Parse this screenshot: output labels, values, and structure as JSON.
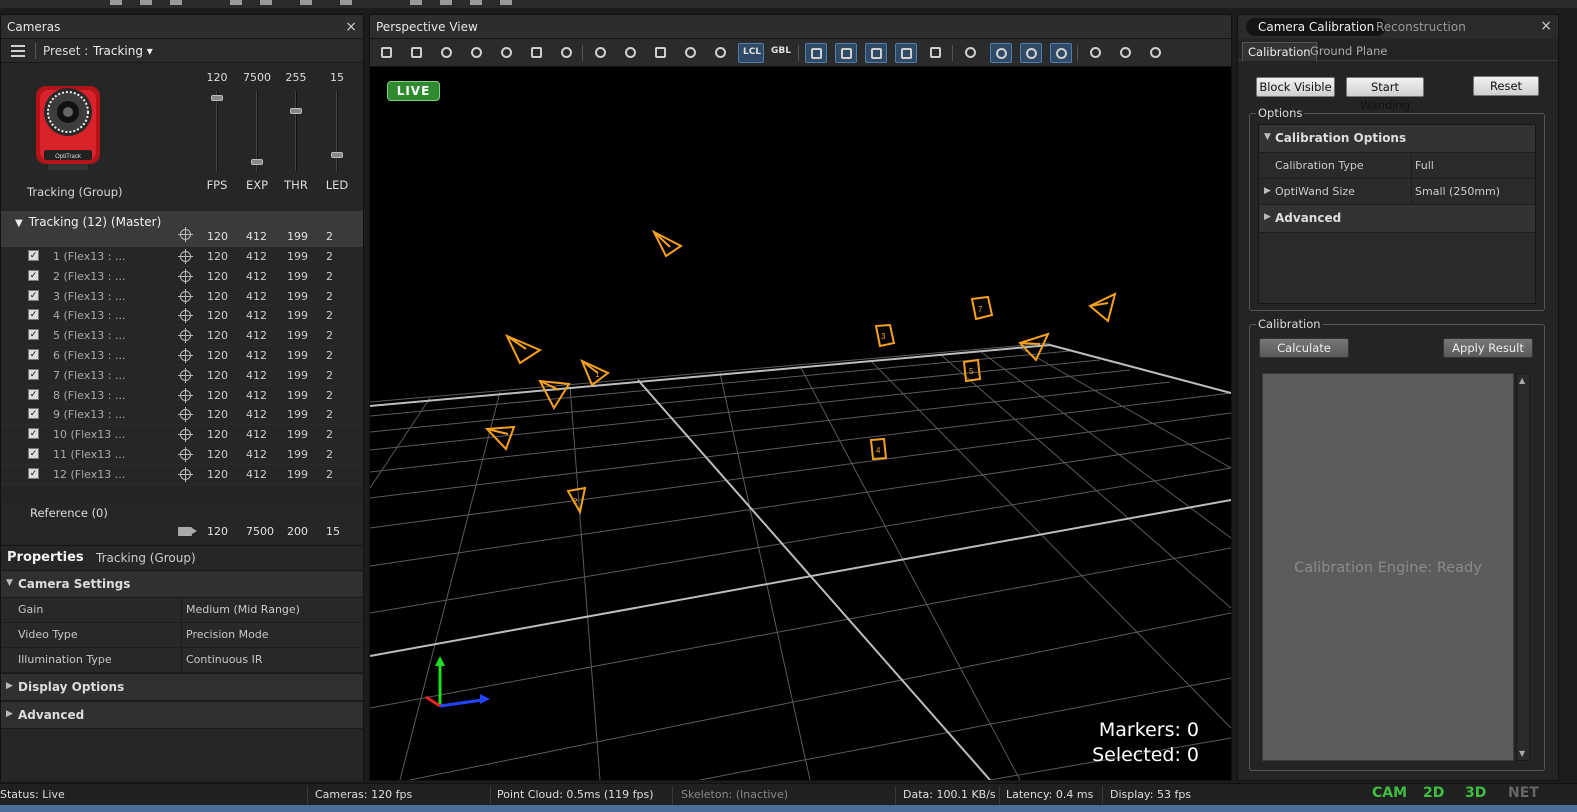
{
  "cameras_panel": {
    "title": "Cameras",
    "close": "×",
    "preset_label": "Preset :",
    "preset_value": "Tracking ▾",
    "camera_image_label": "Tracking (Group)",
    "sliders": [
      {
        "value": "120",
        "label": "FPS",
        "level": 0.95
      },
      {
        "value": "7500",
        "label": "EXP",
        "level": 0.1
      },
      {
        "value": "255",
        "label": "THR",
        "level": 0.78
      },
      {
        "value": "15",
        "label": "LED",
        "level": 0.2
      }
    ]
  },
  "group": {
    "title": "Tracking (12) (Master)",
    "fps": "120",
    "exp": "412",
    "thr": "199",
    "led": "2"
  },
  "camera_rows": [
    {
      "name": "1  (Flex13  : ...",
      "fps": "120",
      "exp": "412",
      "thr": "199",
      "led": "2"
    },
    {
      "name": "2  (Flex13  : ...",
      "fps": "120",
      "exp": "412",
      "thr": "199",
      "led": "2"
    },
    {
      "name": "3  (Flex13  : ...",
      "fps": "120",
      "exp": "412",
      "thr": "199",
      "led": "2"
    },
    {
      "name": "4  (Flex13  : ...",
      "fps": "120",
      "exp": "412",
      "thr": "199",
      "led": "2"
    },
    {
      "name": "5  (Flex13  : ...",
      "fps": "120",
      "exp": "412",
      "thr": "199",
      "led": "2"
    },
    {
      "name": "6  (Flex13  : ...",
      "fps": "120",
      "exp": "412",
      "thr": "199",
      "led": "2"
    },
    {
      "name": "7  (Flex13  : ...",
      "fps": "120",
      "exp": "412",
      "thr": "199",
      "led": "2"
    },
    {
      "name": "8  (Flex13  : ...",
      "fps": "120",
      "exp": "412",
      "thr": "199",
      "led": "2"
    },
    {
      "name": "9  (Flex13  : ...",
      "fps": "120",
      "exp": "412",
      "thr": "199",
      "led": "2"
    },
    {
      "name": "10  (Flex13  ...",
      "fps": "120",
      "exp": "412",
      "thr": "199",
      "led": "2"
    },
    {
      "name": "11  (Flex13  ...",
      "fps": "120",
      "exp": "412",
      "thr": "199",
      "led": "2"
    },
    {
      "name": "12  (Flex13  ...",
      "fps": "120",
      "exp": "412",
      "thr": "199",
      "led": "2"
    }
  ],
  "reference": {
    "label": "Reference (0)",
    "fps": "120",
    "exp": "7500",
    "thr": "200",
    "led": "15"
  },
  "properties": {
    "title": "Properties",
    "subtitle": "Tracking (Group)",
    "camera_settings": "Camera Settings",
    "rows": [
      {
        "key": "Gain",
        "value": "Medium (Mid Range)"
      },
      {
        "key": "Video Type",
        "value": "Precision Mode"
      },
      {
        "key": "Illumination Type",
        "value": "Continuous IR"
      }
    ],
    "display_options": "Display Options",
    "advanced": "Advanced"
  },
  "view_panel": {
    "title": "Perspective View",
    "live": "LIVE",
    "lcl": "LCL",
    "gbl": "GBL",
    "markers": "Markers: 0",
    "selected": "Selected: 0",
    "camera_labels": [
      "1",
      "2",
      "3",
      "4",
      "5",
      "6",
      "7"
    ]
  },
  "calib_panel": {
    "tab_active": "Camera Calibration",
    "tab_other": "Reconstruction",
    "close": "×",
    "subtab_active": "Calibration",
    "subtab_other": "Ground Plane",
    "block_visible": "Block Visible",
    "start_wanding": "Start Wanding",
    "reset": "Reset",
    "options_legend": "Options",
    "calibration_options": "Calibration Options",
    "calibration_type_key": "Calibration Type",
    "calibration_type_value": "Full",
    "wand_size_key": "OptiWand Size",
    "wand_size_value": "Small (250mm)",
    "advanced": "Advanced",
    "calibration_legend": "Calibration",
    "calculate": "Calculate",
    "apply_result": "Apply Result",
    "engine_status": "Calibration Engine: Ready"
  },
  "status_bar": {
    "status": "Status: Live",
    "cameras": "Cameras: 120 fps",
    "point_cloud": "Point Cloud: 0.5ms (119 fps)",
    "skeleton": "Skeleton: (Inactive)",
    "data": "Data: 100.1 KB/s",
    "latency": "Latency: 0.4 ms",
    "display": "Display: 53 fps",
    "mode_cam": "CAM",
    "mode_2d": "2D",
    "mode_3d": "3D",
    "mode_net": "NET"
  },
  "colors": {
    "accent_orange": "#f5a01e",
    "grid": "#6a6a6a",
    "mode_green": "#3fbf3f",
    "mode_inactive": "#666666"
  }
}
